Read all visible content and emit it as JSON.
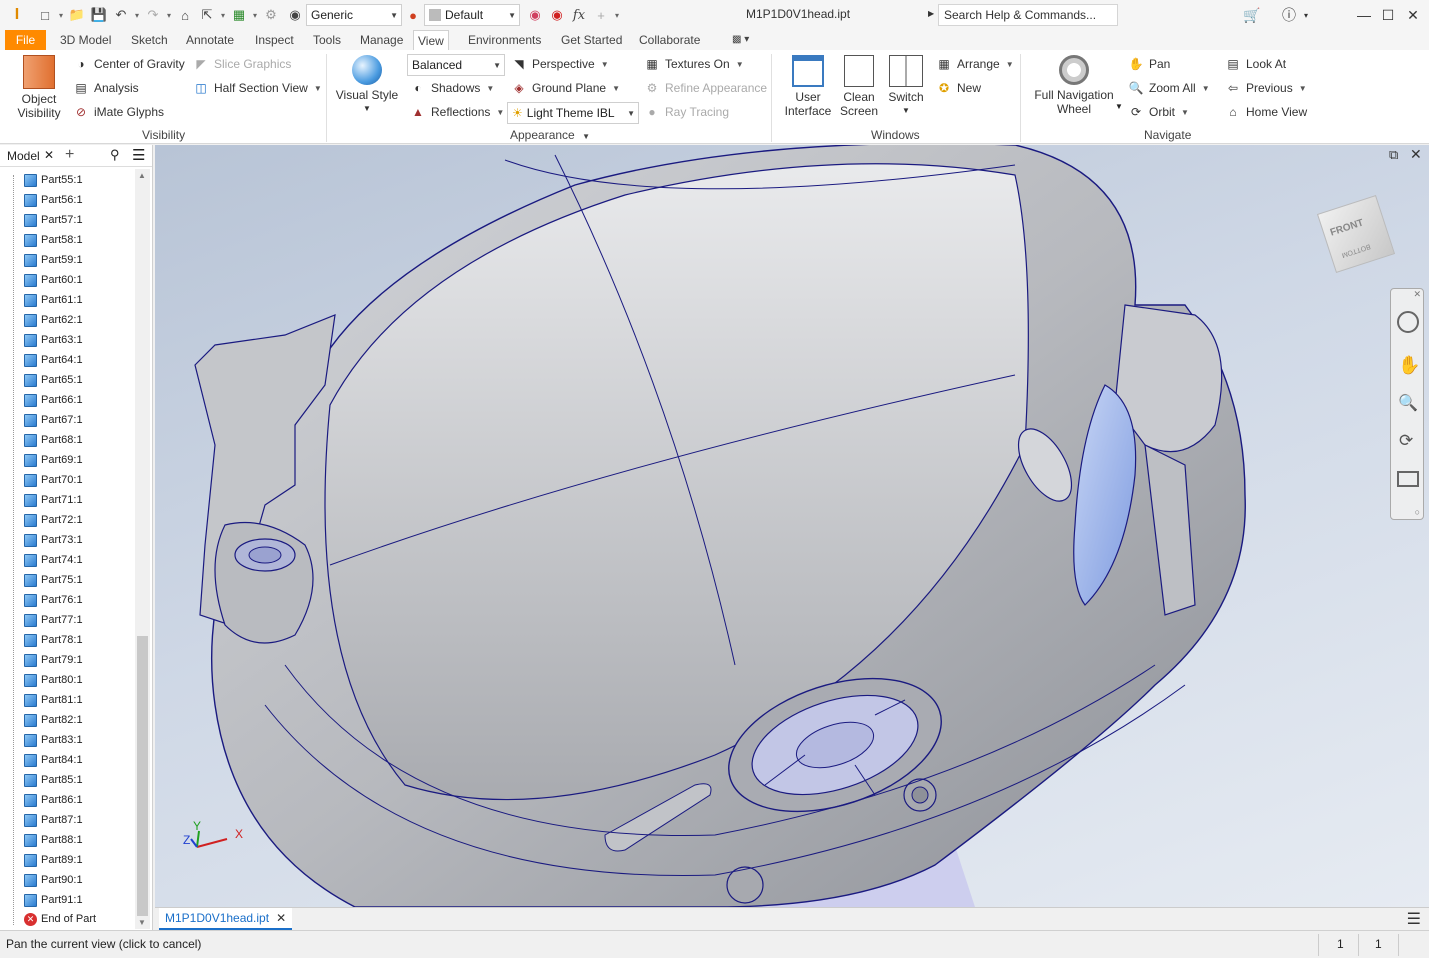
{
  "titlebar": {
    "app_icon": "inventor-i-logo",
    "material_combo": "Generic",
    "appearance_combo": "Default",
    "document_title": "M1P1D0V1head.ipt",
    "search_placeholder": "Search Help & Commands..."
  },
  "tabs": [
    "File",
    "3D Model",
    "Sketch",
    "Annotate",
    "Inspect",
    "Tools",
    "Manage",
    "View",
    "Environments",
    "Get Started",
    "Collaborate"
  ],
  "active_tab": "View",
  "ribbon": {
    "visibility": {
      "object_visibility": "Object\nVisibility",
      "center_of_gravity": "Center of Gravity",
      "analysis": "Analysis",
      "imate_glyphs": "iMate Glyphs",
      "slice_graphics": "Slice Graphics",
      "half_section_view": "Half Section View",
      "panel_label": "Visibility"
    },
    "appearance": {
      "visual_style": "Visual Style",
      "quality_combo": "Balanced",
      "shadows": "Shadows",
      "reflections": "Reflections",
      "perspective": "Perspective",
      "ground_plane": "Ground Plane",
      "lighting_combo": "Light Theme IBL",
      "textures_on": "Textures On",
      "refine_appearance": "Refine Appearance",
      "ray_tracing": "Ray Tracing",
      "panel_label": "Appearance"
    },
    "windows": {
      "user_interface": "User\nInterface",
      "clean_screen": "Clean\nScreen",
      "switch": "Switch",
      "arrange": "Arrange",
      "new": "New",
      "panel_label": "Windows"
    },
    "navigate": {
      "full_navigation_wheel": "Full Navigation\nWheel",
      "pan": "Pan",
      "zoom_all": "Zoom All",
      "orbit": "Orbit",
      "look_at": "Look At",
      "previous": "Previous",
      "home_view": "Home View",
      "panel_label": "Navigate"
    }
  },
  "browser": {
    "tab_label": "Model",
    "items": [
      "Part55:1",
      "Part56:1",
      "Part57:1",
      "Part58:1",
      "Part59:1",
      "Part60:1",
      "Part61:1",
      "Part62:1",
      "Part63:1",
      "Part64:1",
      "Part65:1",
      "Part66:1",
      "Part67:1",
      "Part68:1",
      "Part69:1",
      "Part70:1",
      "Part71:1",
      "Part72:1",
      "Part73:1",
      "Part74:1",
      "Part75:1",
      "Part76:1",
      "Part77:1",
      "Part78:1",
      "Part79:1",
      "Part80:1",
      "Part81:1",
      "Part82:1",
      "Part83:1",
      "Part84:1",
      "Part85:1",
      "Part86:1",
      "Part87:1",
      "Part88:1",
      "Part89:1",
      "Part90:1",
      "Part91:1"
    ],
    "end_item": "End of Part"
  },
  "viewcube": {
    "front": "FRONT",
    "bottom": "BOTTOM"
  },
  "axis_triad": {
    "x": "X",
    "y": "Y",
    "z": "Z"
  },
  "document_tab": "M1P1D0V1head.ipt",
  "status": {
    "message": "Pan the current view (click to cancel)",
    "count1": "1",
    "count2": "1"
  },
  "colors": {
    "file_tab": "#ff8a00",
    "accent_blue": "#1a6fc9",
    "model_edges": "#1a1a80",
    "model_face": "#b9bcc3"
  }
}
